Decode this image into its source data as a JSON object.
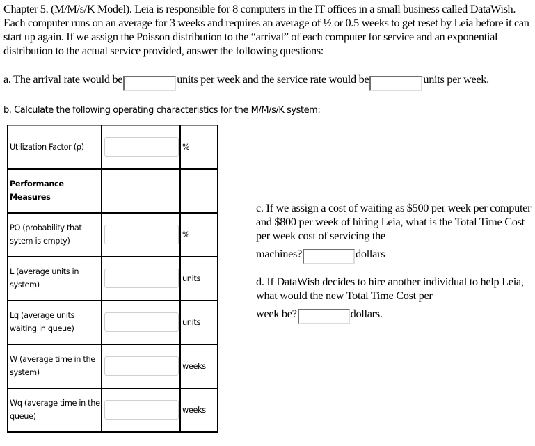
{
  "intro": {
    "text": "Chapter 5. (M/M/s/K Model). Leia is responsible for 8 computers in the IT offices in a small business called DataWish. Each computer runs on an average for 3 weeks and requires an average of ½ or 0.5 weeks to get reset by Leia before it can start up again. If we assign the Poisson distribution to the “arrival” of each computer for service and an exponential distribution to the actual service provided, answer the following questions:"
  },
  "part_a": {
    "prefix": "a. The arrival rate would be",
    "arrival_rate_value": "",
    "middle": "units per week and the service rate would be",
    "service_rate_value": "",
    "suffix": "units per week."
  },
  "part_b": {
    "heading": "b. Calculate the following operating characteristics for the M/M/s/K system:",
    "rows": [
      {
        "label": "Utilization Factor (ρ)",
        "value": "",
        "unit": "%",
        "has_input": true,
        "bold": false
      },
      {
        "label": "Performance Measures",
        "value": "",
        "unit": "",
        "has_input": false,
        "bold": true
      },
      {
        "label": "PO (probability that sytem is empty)",
        "value": "",
        "unit": "%",
        "has_input": true,
        "bold": false
      },
      {
        "label": "L (average units in system)",
        "value": "",
        "unit": "units",
        "has_input": true,
        "bold": false
      },
      {
        "label": "Lq (average units waiting in queue)",
        "value": "",
        "unit": "units",
        "has_input": true,
        "bold": false
      },
      {
        "label": "W (average time in the system)",
        "value": "",
        "unit": "weeks",
        "has_input": true,
        "bold": false
      },
      {
        "label": "Wq (average time in the queue)",
        "value": "",
        "unit": "weeks",
        "has_input": true,
        "bold": false
      }
    ]
  },
  "part_c": {
    "text": "c. If we assign a cost of waiting as $500 per week per computer and $800 per week of hiring Leia, what is the Total Time Cost per week cost of servicing the",
    "prompt": "machines?",
    "value": "",
    "suffix": "dollars"
  },
  "part_d": {
    "text": "d. If DataWish decides to hire another individual to help Leia, what would the new Total Time Cost per",
    "prompt": "week be?",
    "value": "",
    "suffix": "dollars."
  }
}
